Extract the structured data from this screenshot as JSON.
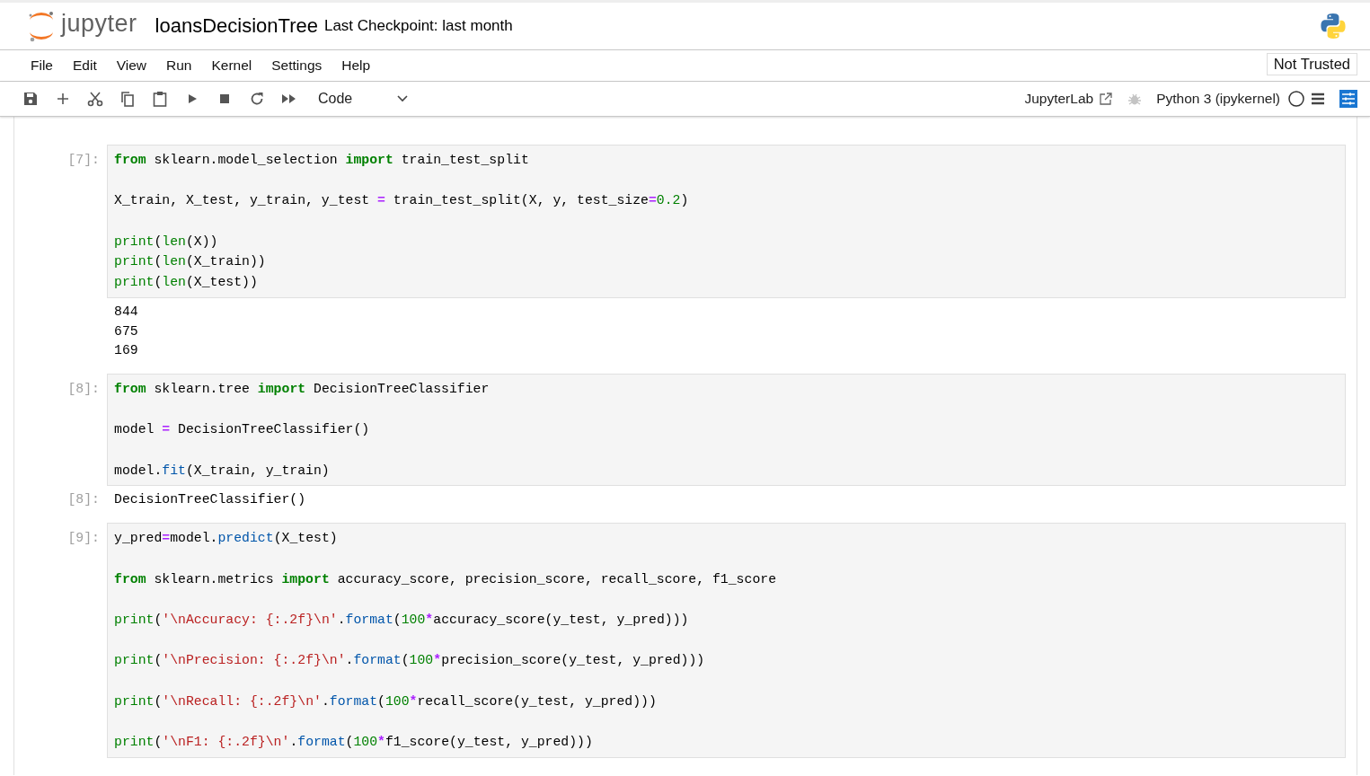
{
  "header": {
    "logo_text": "jupyter",
    "notebook_name": "loansDecisionTree",
    "checkpoint": "Last Checkpoint: last month"
  },
  "menu": [
    "File",
    "Edit",
    "View",
    "Run",
    "Kernel",
    "Settings",
    "Help"
  ],
  "trust_button": "Not Trusted",
  "toolbar": {
    "cell_type": "Code",
    "jupyterlab_link": "JupyterLab",
    "debugger_enabled": false,
    "kernel_name": "Python 3 (ipykernel)",
    "kernel_busy": false
  },
  "cells": [
    {
      "prompt": "[7]:",
      "lines": [
        {
          "spaced": false,
          "tokens": [
            {
              "kind": "keyword",
              "text": "from"
            },
            {
              "kind": "plain",
              "text": " sklearn.model_selection "
            },
            {
              "kind": "keyword",
              "text": "import"
            },
            {
              "kind": "plain",
              "text": " train_test_split"
            }
          ]
        },
        {
          "spaced": true,
          "tokens": [
            {
              "kind": "plain",
              "text": "X_train, X_test, y_train, y_test "
            },
            {
              "kind": "operator",
              "text": "="
            },
            {
              "kind": "plain",
              "text": " train_test_split(X, y, test_size"
            },
            {
              "kind": "operator",
              "text": "="
            },
            {
              "kind": "number",
              "text": "0.2"
            },
            {
              "kind": "plain",
              "text": ")"
            }
          ]
        },
        {
          "spaced": true,
          "tokens": [
            {
              "kind": "builtin",
              "text": "print"
            },
            {
              "kind": "plain",
              "text": "("
            },
            {
              "kind": "builtin",
              "text": "len"
            },
            {
              "kind": "plain",
              "text": "(X))"
            }
          ]
        },
        {
          "spaced": false,
          "tokens": [
            {
              "kind": "builtin",
              "text": "print"
            },
            {
              "kind": "plain",
              "text": "("
            },
            {
              "kind": "builtin",
              "text": "len"
            },
            {
              "kind": "plain",
              "text": "(X_train))"
            }
          ]
        },
        {
          "spaced": false,
          "tokens": [
            {
              "kind": "builtin",
              "text": "print"
            },
            {
              "kind": "plain",
              "text": "("
            },
            {
              "kind": "builtin",
              "text": "len"
            },
            {
              "kind": "plain",
              "text": "(X_test))"
            }
          ]
        }
      ],
      "output": {
        "lines": [
          "844",
          "675",
          "169"
        ]
      }
    },
    {
      "prompt": "[8]:",
      "lines": [
        {
          "spaced": false,
          "tokens": [
            {
              "kind": "keyword",
              "text": "from"
            },
            {
              "kind": "plain",
              "text": " sklearn.tree "
            },
            {
              "kind": "keyword",
              "text": "import"
            },
            {
              "kind": "plain",
              "text": " DecisionTreeClassifier"
            }
          ]
        },
        {
          "spaced": true,
          "tokens": [
            {
              "kind": "plain",
              "text": "model "
            },
            {
              "kind": "operator",
              "text": "="
            },
            {
              "kind": "plain",
              "text": " DecisionTreeClassifier()"
            }
          ]
        },
        {
          "spaced": true,
          "tokens": [
            {
              "kind": "plain",
              "text": "model."
            },
            {
              "kind": "method",
              "text": "fit"
            },
            {
              "kind": "plain",
              "text": "(X_train, y_train)"
            }
          ]
        }
      ],
      "output": {
        "prompt": "[8]:",
        "lines": [
          "DecisionTreeClassifier()"
        ]
      }
    },
    {
      "prompt": "[9]:",
      "lines": [
        {
          "spaced": false,
          "tokens": [
            {
              "kind": "plain",
              "text": "y_pred"
            },
            {
              "kind": "operator",
              "text": "="
            },
            {
              "kind": "plain",
              "text": "model."
            },
            {
              "kind": "method",
              "text": "predict"
            },
            {
              "kind": "plain",
              "text": "(X_test)"
            }
          ]
        },
        {
          "spaced": true,
          "tokens": [
            {
              "kind": "keyword",
              "text": "from"
            },
            {
              "kind": "plain",
              "text": " sklearn.metrics "
            },
            {
              "kind": "keyword",
              "text": "import"
            },
            {
              "kind": "plain",
              "text": " accuracy_score, precision_score, recall_score, f1_score"
            }
          ]
        },
        {
          "spaced": true,
          "tokens": [
            {
              "kind": "builtin",
              "text": "print"
            },
            {
              "kind": "plain",
              "text": "("
            },
            {
              "kind": "string",
              "text": "'\\nAccuracy: {:.2f}\\n'"
            },
            {
              "kind": "plain",
              "text": "."
            },
            {
              "kind": "method",
              "text": "format"
            },
            {
              "kind": "plain",
              "text": "("
            },
            {
              "kind": "number",
              "text": "100"
            },
            {
              "kind": "operator",
              "text": "*"
            },
            {
              "kind": "plain",
              "text": "accuracy_score(y_test, y_pred)))"
            }
          ]
        },
        {
          "spaced": true,
          "tokens": [
            {
              "kind": "builtin",
              "text": "print"
            },
            {
              "kind": "plain",
              "text": "("
            },
            {
              "kind": "string",
              "text": "'\\nPrecision: {:.2f}\\n'"
            },
            {
              "kind": "plain",
              "text": "."
            },
            {
              "kind": "method",
              "text": "format"
            },
            {
              "kind": "plain",
              "text": "("
            },
            {
              "kind": "number",
              "text": "100"
            },
            {
              "kind": "operator",
              "text": "*"
            },
            {
              "kind": "plain",
              "text": "precision_score(y_test, y_pred)))"
            }
          ]
        },
        {
          "spaced": true,
          "tokens": [
            {
              "kind": "builtin",
              "text": "print"
            },
            {
              "kind": "plain",
              "text": "("
            },
            {
              "kind": "string",
              "text": "'\\nRecall: {:.2f}\\n'"
            },
            {
              "kind": "plain",
              "text": "."
            },
            {
              "kind": "method",
              "text": "format"
            },
            {
              "kind": "plain",
              "text": "("
            },
            {
              "kind": "number",
              "text": "100"
            },
            {
              "kind": "operator",
              "text": "*"
            },
            {
              "kind": "plain",
              "text": "recall_score(y_test, y_pred)))"
            }
          ]
        },
        {
          "spaced": true,
          "tokens": [
            {
              "kind": "builtin",
              "text": "print"
            },
            {
              "kind": "plain",
              "text": "("
            },
            {
              "kind": "string",
              "text": "'\\nF1: {:.2f}\\n'"
            },
            {
              "kind": "plain",
              "text": "."
            },
            {
              "kind": "method",
              "text": "format"
            },
            {
              "kind": "plain",
              "text": "("
            },
            {
              "kind": "number",
              "text": "100"
            },
            {
              "kind": "operator",
              "text": "*"
            },
            {
              "kind": "plain",
              "text": "f1_score(y_test, y_pred)))"
            }
          ]
        }
      ]
    }
  ]
}
